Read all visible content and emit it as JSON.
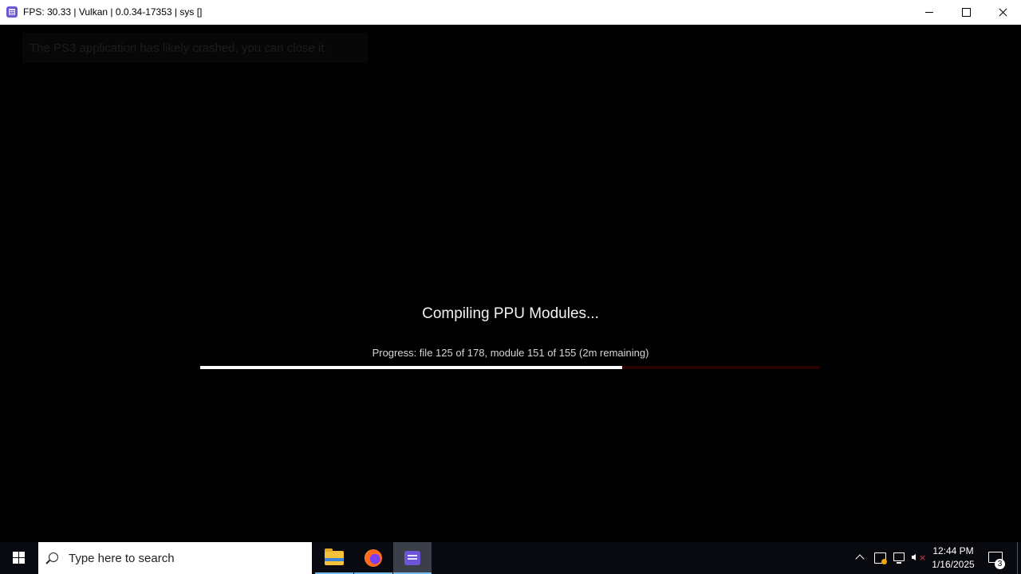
{
  "window": {
    "title": "FPS: 30.33 | Vulkan | 0.0.34-17353 | sys []",
    "icon": "rpcs3-icon"
  },
  "overlay": {
    "crash_message": "The PS3 application has likely crashed, you can close it."
  },
  "compile": {
    "title": "Compiling PPU Modules...",
    "progress_text": "Progress: file 125 of 178, module 151 of 155 (2m remaining)",
    "progress_fraction": 0.682,
    "track_color": "#2a0000",
    "fill_color": "#ffffff"
  },
  "taskbar": {
    "search_placeholder": "Type here to search",
    "apps": [
      {
        "name": "File Explorer",
        "icon": "folder-icon"
      },
      {
        "name": "Firefox",
        "icon": "firefox-icon"
      },
      {
        "name": "RPCS3",
        "icon": "rpcs3-icon",
        "active": true
      }
    ],
    "clock": {
      "time": "12:44 PM",
      "date": "1/16/2025"
    },
    "notification_count": "3"
  }
}
